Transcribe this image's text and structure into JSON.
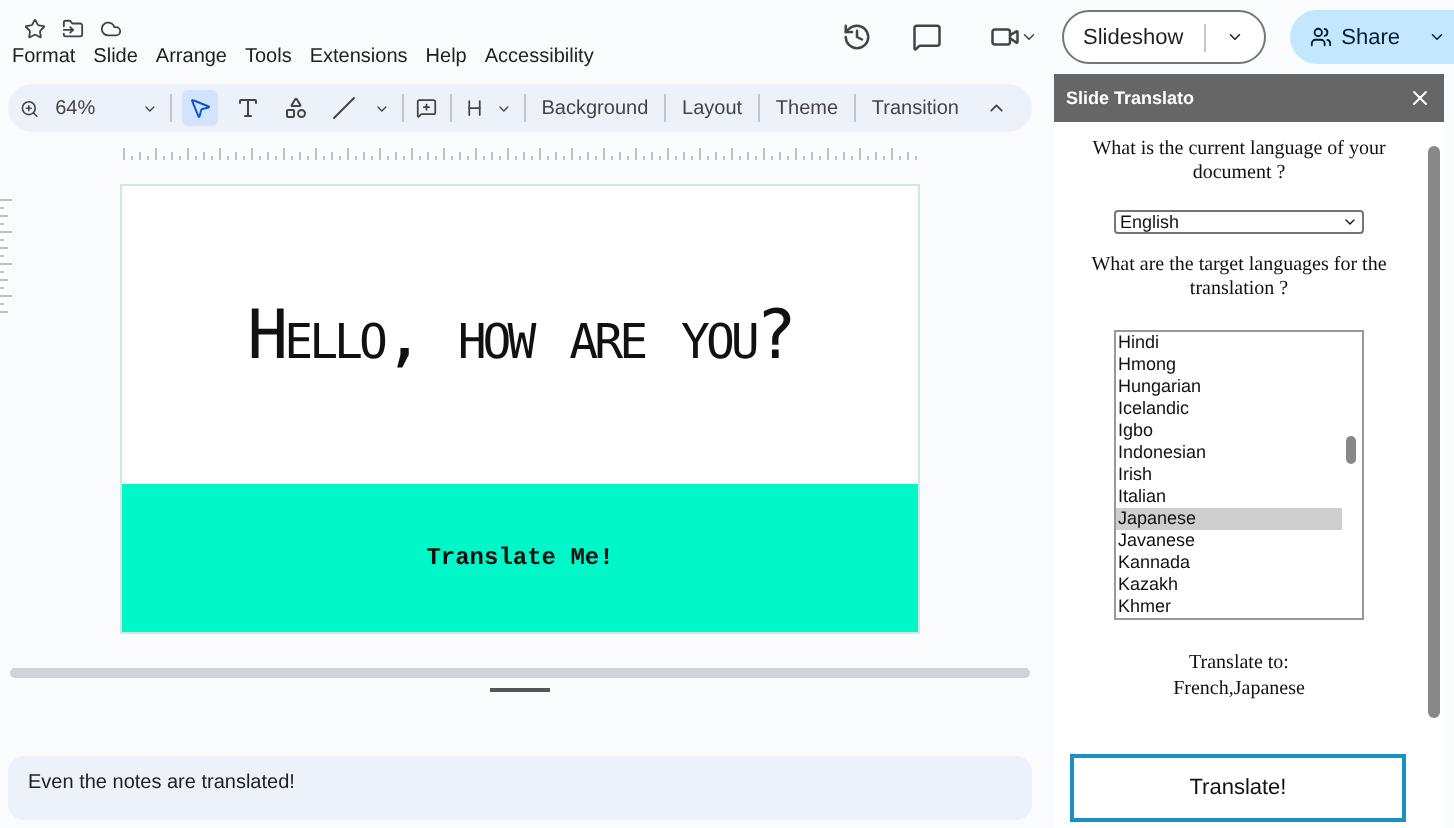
{
  "menu": [
    "Format",
    "Slide",
    "Arrange",
    "Tools",
    "Extensions",
    "Help",
    "Accessibility"
  ],
  "header": {
    "slideshow": "Slideshow",
    "share": "Share"
  },
  "toolbar": {
    "zoom": "64%",
    "tools": [
      {
        "kind": "select",
        "selected": true
      },
      {
        "kind": "text",
        "selected": false
      },
      {
        "kind": "shape",
        "selected": false
      },
      {
        "kind": "line",
        "selected": false
      }
    ],
    "actions": [
      "Background",
      "Layout",
      "Theme",
      "Transition"
    ]
  },
  "slide": {
    "title": "Hello, how are you?",
    "band_text": "Translate Me!"
  },
  "notes": "Even the notes are translated!",
  "panel": {
    "title": "Slide Translato",
    "question_1": "What is the current language of your document ?",
    "source_language": "English",
    "question_2": "What are the target languages for the translation ?",
    "languages": [
      {
        "label": "Hindi",
        "selected": false
      },
      {
        "label": "Hmong",
        "selected": false
      },
      {
        "label": "Hungarian",
        "selected": false
      },
      {
        "label": "Icelandic",
        "selected": false
      },
      {
        "label": "Igbo",
        "selected": false
      },
      {
        "label": "Indonesian",
        "selected": false
      },
      {
        "label": "Irish",
        "selected": false
      },
      {
        "label": "Italian",
        "selected": false
      },
      {
        "label": "Japanese",
        "selected": true
      },
      {
        "label": "Javanese",
        "selected": false
      },
      {
        "label": "Kannada",
        "selected": false
      },
      {
        "label": "Kazakh",
        "selected": false
      },
      {
        "label": "Khmer",
        "selected": false
      }
    ],
    "result_label": "Translate to:",
    "result_value": "French,Japanese",
    "button": "Translate!"
  }
}
